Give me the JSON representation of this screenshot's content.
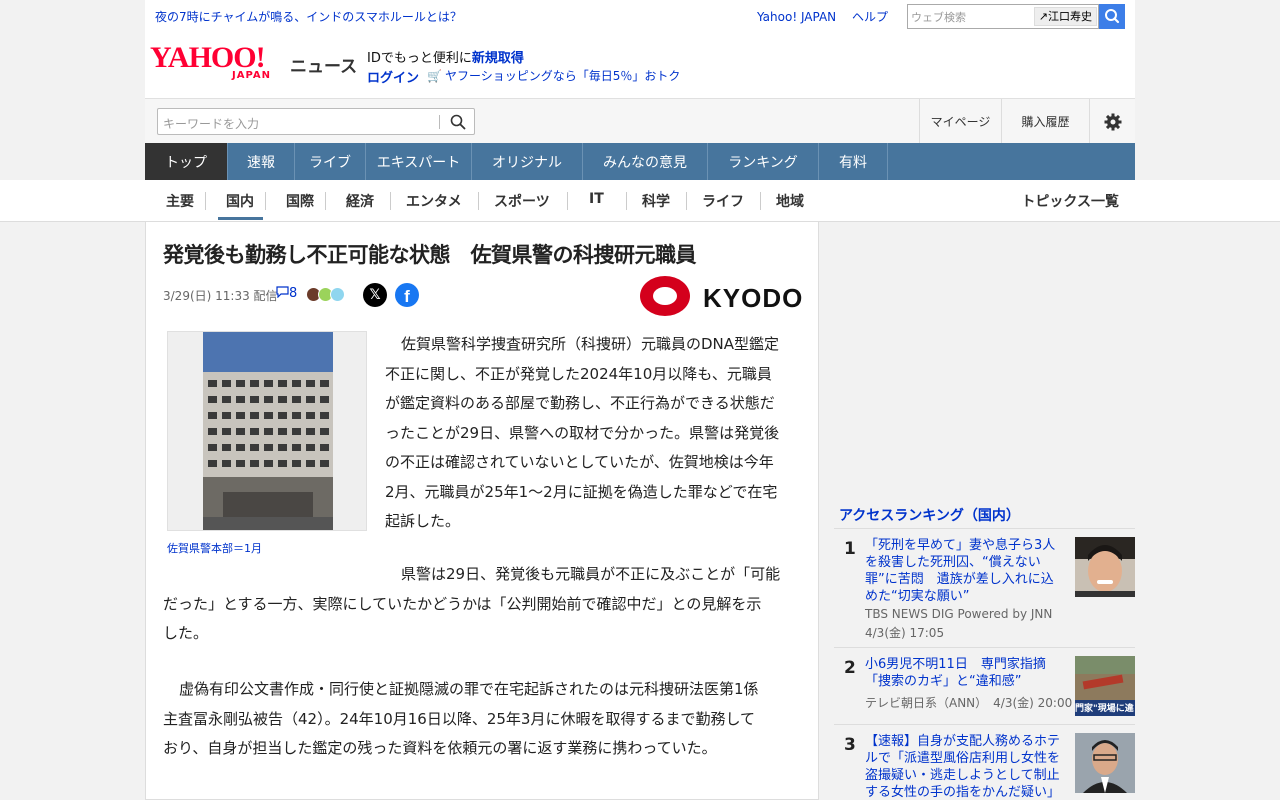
{
  "topbar": {
    "promo": "夜の7時にチャイムが鳴る、インドのスマホルールとは？",
    "links": [
      "Yahoo! JAPAN",
      "ヘルプ"
    ],
    "search_placeholder": "ウェブ検索",
    "search_suggest": "江口寿史"
  },
  "header": {
    "logo_text": "YAHOO!",
    "logo_sub": "JAPAN",
    "section": "ニュース",
    "msg_prefix": "IDでもっと便利に",
    "msg_link": "新規取得",
    "login": "ログイン",
    "shop": "ヤフーショッピングなら「毎日5％」おトク"
  },
  "searchbar": {
    "placeholder": "キーワードを入力",
    "mypage": "マイページ",
    "history": "購入履歴"
  },
  "mainnav": [
    "トップ",
    "速報",
    "ライブ",
    "エキスパート",
    "オリジナル",
    "みんなの意見",
    "ランキング",
    "有料"
  ],
  "subnav": {
    "items": [
      "主要",
      "国内",
      "国際",
      "経済",
      "エンタメ",
      "スポーツ",
      "IT",
      "科学",
      "ライフ",
      "地域"
    ],
    "active": "国内",
    "topics": "トピックス一覧"
  },
  "article": {
    "title": "発覚後も勤務し不正可能な状態　佐賀県警の科捜研元職員",
    "date": "3/29(日) 11:33",
    "delivered": "配信",
    "comments": "8",
    "source": "KYODO",
    "caption": "佐賀県警本部＝1月",
    "p1": [
      "佐賀県警科学捜査研究所（科捜研）元職員のDNA型鑑定",
      "不正に関し、不正が発覚した2024年10月以降も、元職員",
      "が鑑定資料のある部屋で勤務し、不正行為ができる状態だ",
      "ったことが29日、県警への取材で分かった。県警は発覚後",
      "の不正は確認されていないとしていたが、佐賀地検は今年",
      "2月、元職員が25年1～2月に証拠を偽造した罪などで在宅",
      "起訴した。"
    ],
    "p2": [
      "県警は29日、発覚後も元職員が不正に及ぶことが「可能",
      "だった」とする一方、実際にしていたかどうかは「公判開始前で確認中だ」との見解を示",
      "した。"
    ],
    "p3": [
      "虚偽有印公文書作成・同行使と証拠隠滅の罪で在宅起訴されたのは元科捜研法医第1係",
      "主査冨永剛弘被告（42）。24年10月16日以降、25年3月に休暇を取得するまで勤務して",
      "おり、自身が担当した鑑定の残った資料を依頼元の署に返す業務に携わっていた。"
    ]
  },
  "ranking": {
    "title": "アクセスランキング（国内）",
    "items": [
      {
        "rank": "1",
        "headline": "「死刑を早めて」妻や息子ら3人を殺害した死刑囚、“償えない罪”に苦悶　遺族が差し入れに込めた“切実な願い”",
        "source": "TBS NEWS DIG Powered by JNN",
        "date": "4/3(金) 17:05"
      },
      {
        "rank": "2",
        "headline": "小6男児不明11日　専門家指摘「捜索のカギ」と“違和感”",
        "source": "テレビ朝日系（ANN）　4/3(金) 20:00",
        "date": ""
      },
      {
        "rank": "3",
        "headline": "【速報】自身が支配人務めるホテルで「派遣型風俗店利用し女性を盗撮疑い・逃走しようとして制止する女性の手の指をかんだ疑い」",
        "source": "",
        "date": ""
      }
    ],
    "thumb2_text": "門家\"現場に違"
  }
}
